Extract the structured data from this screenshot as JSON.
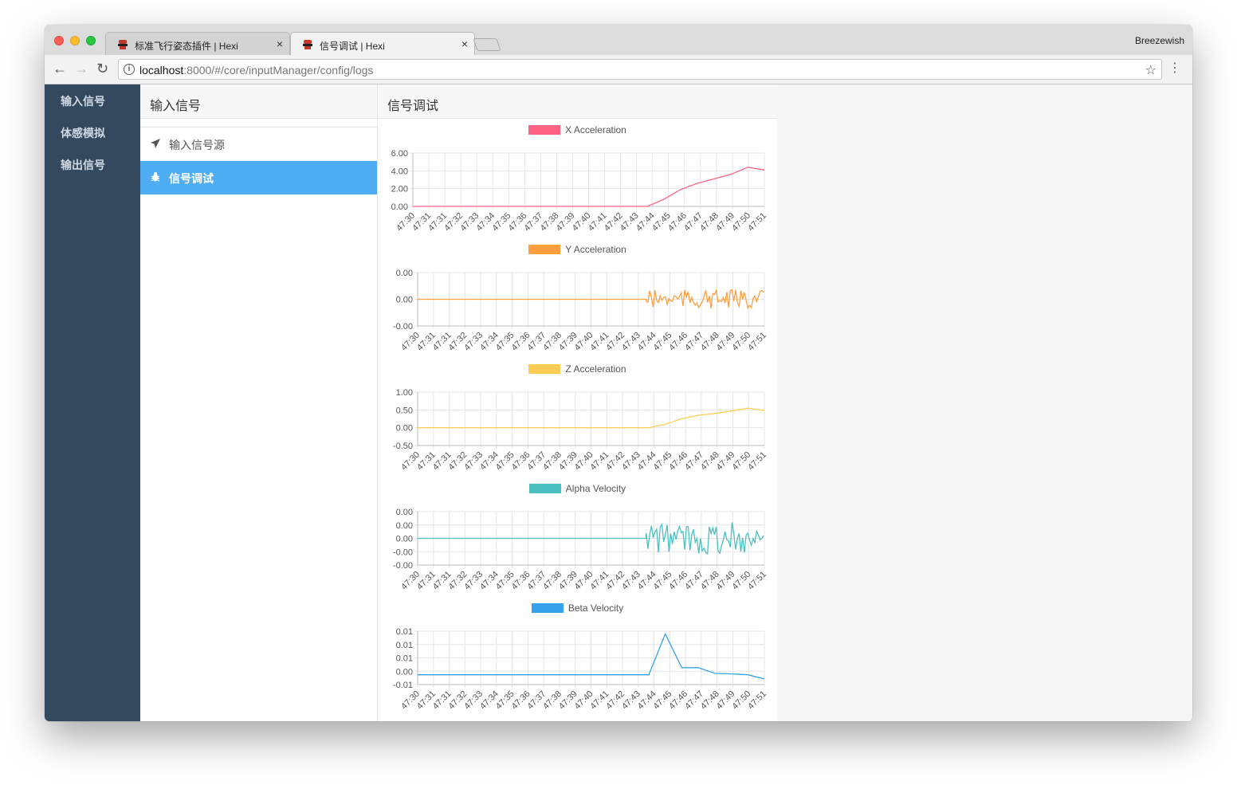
{
  "browser": {
    "tabs": [
      {
        "title": "标准飞行姿态插件 | Hexi",
        "close": "×"
      },
      {
        "title": "信号调试 | Hexi",
        "close": "×"
      }
    ],
    "profile": "Breezewish",
    "url_host": "localhost",
    "url_rest": ":8000/#/core/inputManager/config/logs",
    "info_icon": "i",
    "star_icon": "☆",
    "menu_icon": "⋮",
    "back_icon": "←",
    "forward_icon": "→",
    "reload_icon": "↻"
  },
  "sidebar": {
    "items": [
      {
        "label": "输入信号"
      },
      {
        "label": "体感模拟"
      },
      {
        "label": "输出信号"
      }
    ]
  },
  "subnav": {
    "header": "输入信号",
    "items": [
      {
        "label": "输入信号源",
        "icon": "paper-plane-icon",
        "active": false
      },
      {
        "label": "信号调试",
        "icon": "bug-icon",
        "active": true
      }
    ]
  },
  "main": {
    "header": "信号调试"
  },
  "colors": {
    "sidebar_bg": "#34495e",
    "active_item": "#4fadf3",
    "x_accel": "#ff6384",
    "y_accel": "#ff9f40",
    "z_accel": "#ffcd56",
    "alpha_vel": "#4bc0c0",
    "beta_vel": "#36a2eb"
  },
  "chart_data": [
    {
      "type": "line",
      "series": [
        {
          "name": "X Acceleration",
          "color": "#ff6384",
          "values": [
            0,
            0,
            0,
            0,
            0,
            0,
            0,
            0,
            0,
            0,
            0,
            0,
            0,
            0,
            0,
            0.8,
            1.9,
            2.6,
            3.1,
            3.6,
            4.4,
            4.1
          ]
        }
      ],
      "x": [
        "47:30",
        "47:31",
        "47:31",
        "47:32",
        "47:33",
        "47:34",
        "47:35",
        "47:36",
        "47:37",
        "47:38",
        "47:39",
        "47:40",
        "47:41",
        "47:42",
        "47:43",
        "47:44",
        "47:45",
        "47:46",
        "47:47",
        "47:48",
        "47:49",
        "47:50",
        "47:51"
      ],
      "yticks": [
        "6.00",
        "4.00",
        "2.00",
        "0.00"
      ],
      "ylim": [
        0,
        6
      ]
    },
    {
      "type": "line",
      "series": [
        {
          "name": "Y Acceleration",
          "color": "#ff9f40",
          "noisy": true
        }
      ],
      "x": [
        "47:30",
        "47:31",
        "47:31",
        "47:32",
        "47:33",
        "47:34",
        "47:35",
        "47:36",
        "47:37",
        "47:38",
        "47:39",
        "47:40",
        "47:41",
        "47:42",
        "47:43",
        "47:44",
        "47:45",
        "47:46",
        "47:47",
        "47:48",
        "47:49",
        "47:50",
        "47:51"
      ],
      "yticks": [
        "0.00",
        "0.00",
        "-0.00"
      ]
    },
    {
      "type": "line",
      "series": [
        {
          "name": "Z Acceleration",
          "color": "#ffcd56",
          "values": [
            0,
            0,
            0,
            0,
            0,
            0,
            0,
            0,
            0,
            0,
            0,
            0,
            0,
            0,
            0,
            0.1,
            0.25,
            0.35,
            0.4,
            0.47,
            0.55,
            0.48
          ]
        }
      ],
      "x": [
        "47:30",
        "47:31",
        "47:31",
        "47:32",
        "47:33",
        "47:34",
        "47:35",
        "47:36",
        "47:37",
        "47:38",
        "47:39",
        "47:40",
        "47:41",
        "47:42",
        "47:43",
        "47:44",
        "47:45",
        "47:46",
        "47:47",
        "47:48",
        "47:49",
        "47:50",
        "47:51"
      ],
      "yticks": [
        "1.00",
        "0.50",
        "0.00",
        "-0.50"
      ],
      "ylim": [
        -0.5,
        1
      ]
    },
    {
      "type": "line",
      "series": [
        {
          "name": "Alpha Velocity",
          "color": "#4bc0c0",
          "noisy": true
        }
      ],
      "x": [
        "47:30",
        "47:31",
        "47:31",
        "47:32",
        "47:33",
        "47:34",
        "47:35",
        "47:36",
        "47:37",
        "47:38",
        "47:39",
        "47:40",
        "47:41",
        "47:42",
        "47:43",
        "47:44",
        "47:45",
        "47:46",
        "47:47",
        "47:48",
        "47:49",
        "47:50",
        "47:51"
      ],
      "yticks": [
        "0.00",
        "0.00",
        "0.00",
        "-0.00",
        "-0.00"
      ]
    },
    {
      "type": "line",
      "series": [
        {
          "name": "Beta Velocity",
          "color": "#36a2eb",
          "values": [
            0,
            0,
            0,
            0,
            0,
            0,
            0,
            0,
            0,
            0,
            0,
            0,
            0,
            0,
            0,
            0.0145,
            0.0025,
            0.0025,
            0.0005,
            0.0003,
            0,
            -0.0015
          ]
        }
      ],
      "x": [
        "47:30",
        "47:31",
        "47:31",
        "47:32",
        "47:33",
        "47:34",
        "47:35",
        "47:36",
        "47:37",
        "47:38",
        "47:39",
        "47:40",
        "47:41",
        "47:42",
        "47:43",
        "47:44",
        "47:45",
        "47:46",
        "47:47",
        "47:48",
        "47:49",
        "47:50",
        "47:51"
      ],
      "yticks": [
        "0.01",
        "0.01",
        "0.01",
        "0.00",
        "-0.01"
      ]
    }
  ]
}
